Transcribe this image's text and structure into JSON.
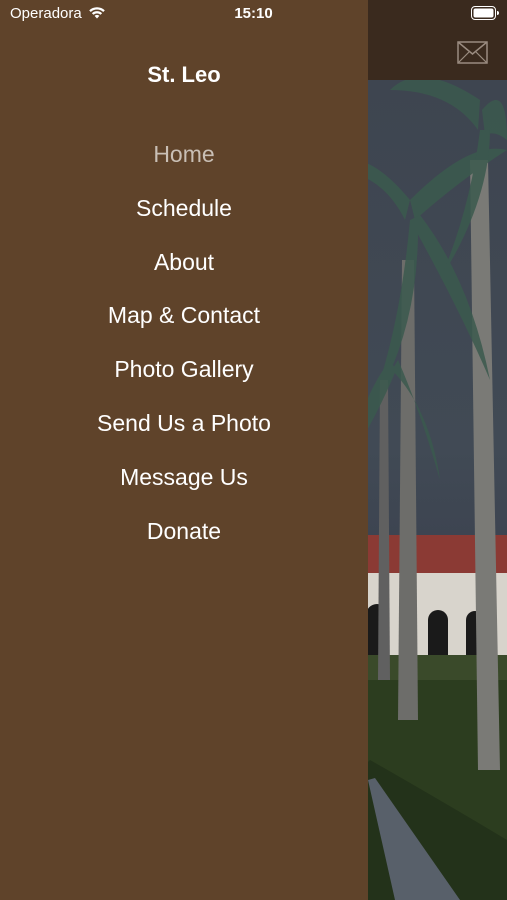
{
  "status_bar": {
    "carrier": "Operadora",
    "time": "15:10"
  },
  "drawer": {
    "title": "St. Leo",
    "active_index": 0,
    "items": [
      {
        "label": "Home"
      },
      {
        "label": "Schedule"
      },
      {
        "label": "About"
      },
      {
        "label": "Map & Contact"
      },
      {
        "label": "Photo Gallery"
      },
      {
        "label": "Send Us a Photo"
      },
      {
        "label": "Message Us"
      },
      {
        "label": "Donate"
      }
    ]
  },
  "header": {
    "icon": "envelope-icon"
  },
  "colors": {
    "drawer_bg": "#5f432a",
    "header_bg": "#3a2a1e",
    "menu_text": "#ffffff",
    "active_text": "#c9bfb5"
  }
}
